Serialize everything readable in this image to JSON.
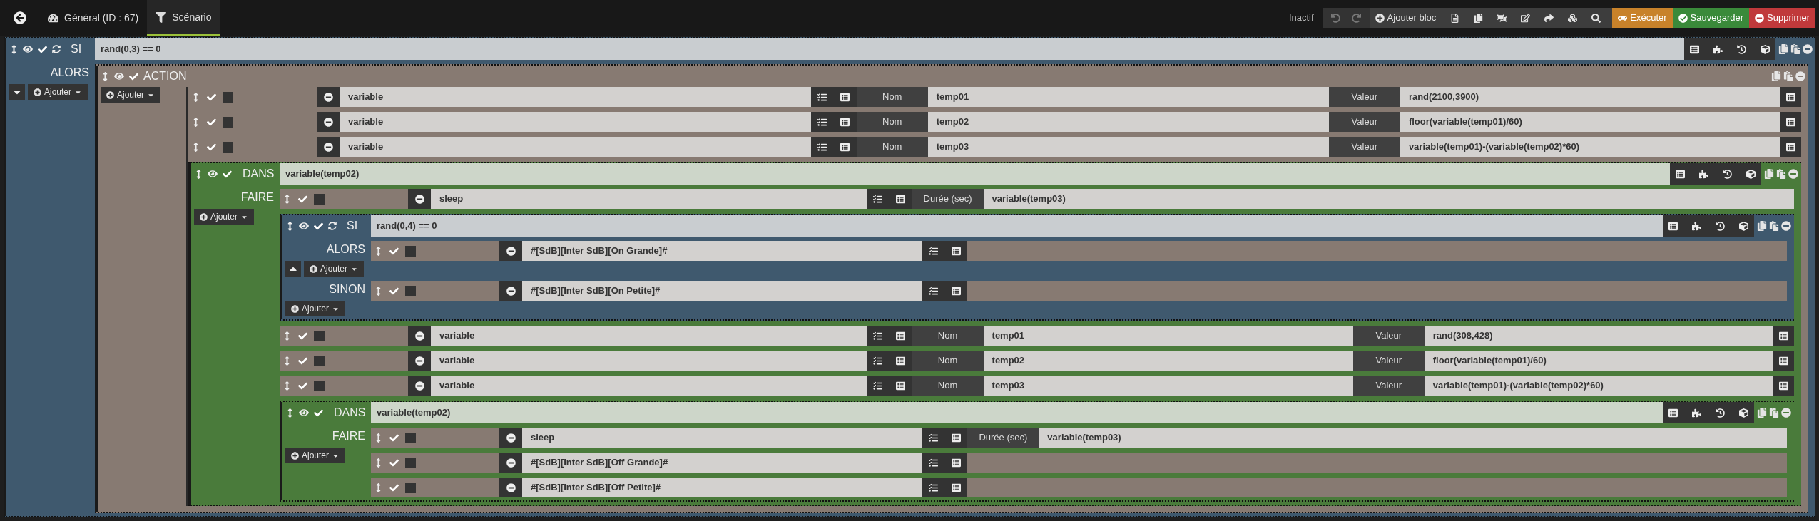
{
  "header": {
    "tabs": [
      {
        "kind": "general",
        "label": "Général (ID : 67)",
        "selected": false
      },
      {
        "kind": "scenario",
        "label": "Scénario",
        "selected": true
      }
    ],
    "state": "Inactif",
    "undo": {
      "disabled": true
    },
    "redo": {
      "disabled": true
    },
    "add_block": "Ajouter bloc",
    "actions": [
      {
        "kind": "run",
        "label": "Exécuter"
      },
      {
        "kind": "save",
        "label": "Sauvegarder"
      },
      {
        "kind": "delete",
        "label": "Supprimer"
      }
    ]
  },
  "scenario": {
    "kind": "si",
    "label": "SI",
    "enabled": true,
    "condition": "rand(0,3) == 0",
    "sections": [
      {
        "label": "ALORS",
        "expanded": false,
        "add_label": "Ajouter",
        "children": [
          {
            "kind": "action",
            "label": "ACTION",
            "enabled": true,
            "add_label": "Ajouter",
            "children": [
              {
                "kind": "element",
                "enabled": true,
                "parallel": false,
                "command": "variable",
                "fields": [
                  {
                    "label": "Nom",
                    "value": "temp01",
                    "picker": false
                  },
                  {
                    "label": "Valeur",
                    "value": "rand(2100,3900)",
                    "picker": true
                  }
                ]
              },
              {
                "kind": "element",
                "enabled": true,
                "parallel": false,
                "command": "variable",
                "fields": [
                  {
                    "label": "Nom",
                    "value": "temp02",
                    "picker": false
                  },
                  {
                    "label": "Valeur",
                    "value": "floor(variable(temp01)/60)",
                    "picker": true
                  }
                ]
              },
              {
                "kind": "element",
                "enabled": true,
                "parallel": false,
                "command": "variable",
                "fields": [
                  {
                    "label": "Nom",
                    "value": "temp03",
                    "picker": false
                  },
                  {
                    "label": "Valeur",
                    "value": "variable(temp01)-(variable(temp02)*60)",
                    "picker": true
                  }
                ]
              },
              {
                "kind": "dans",
                "label": "DANS",
                "enabled": true,
                "condition": "variable(temp02)",
                "sections": [
                  {
                    "label": "FAIRE",
                    "add_label": "Ajouter",
                    "children": [
                      {
                        "kind": "element",
                        "enabled": true,
                        "parallel": false,
                        "command": "sleep",
                        "fields": [
                          {
                            "label": "Durée (sec)",
                            "value": "variable(temp03)",
                            "picker": false
                          }
                        ]
                      },
                      {
                        "kind": "si",
                        "label": "SI",
                        "enabled": true,
                        "condition": "rand(0,4) == 0",
                        "sections": [
                          {
                            "label": "ALORS",
                            "expanded": true,
                            "add_label": "Ajouter",
                            "children": [
                              {
                                "kind": "element",
                                "enabled": true,
                                "parallel": false,
                                "command": "#[SdB][Inter SdB][On Grande]#"
                              }
                            ]
                          },
                          {
                            "label": "SINON",
                            "add_label": "Ajouter",
                            "children": [
                              {
                                "kind": "element",
                                "enabled": true,
                                "parallel": false,
                                "command": "#[SdB][Inter SdB][On Petite]#"
                              }
                            ]
                          }
                        ]
                      },
                      {
                        "kind": "element",
                        "enabled": true,
                        "parallel": false,
                        "command": "variable",
                        "fields": [
                          {
                            "label": "Nom",
                            "value": "temp01",
                            "picker": false
                          },
                          {
                            "label": "Valeur",
                            "value": "rand(308,428)",
                            "picker": true
                          }
                        ]
                      },
                      {
                        "kind": "element",
                        "enabled": true,
                        "parallel": false,
                        "command": "variable",
                        "fields": [
                          {
                            "label": "Nom",
                            "value": "temp02",
                            "picker": false
                          },
                          {
                            "label": "Valeur",
                            "value": "floor(variable(temp01)/60)",
                            "picker": true
                          }
                        ]
                      },
                      {
                        "kind": "element",
                        "enabled": true,
                        "parallel": false,
                        "command": "variable",
                        "fields": [
                          {
                            "label": "Nom",
                            "value": "temp03",
                            "picker": false
                          },
                          {
                            "label": "Valeur",
                            "value": "variable(temp01)-(variable(temp02)*60)",
                            "picker": true
                          }
                        ]
                      },
                      {
                        "kind": "dans",
                        "label": "DANS",
                        "enabled": true,
                        "condition": "variable(temp02)",
                        "sections": [
                          {
                            "label": "FAIRE",
                            "add_label": "Ajouter",
                            "children": [
                              {
                                "kind": "element",
                                "enabled": true,
                                "parallel": false,
                                "command": "sleep",
                                "fields": [
                                  {
                                    "label": "Durée (sec)",
                                    "value": "variable(temp03)",
                                    "picker": false
                                  }
                                ]
                              },
                              {
                                "kind": "element",
                                "enabled": true,
                                "parallel": false,
                                "command": "#[SdB][Inter SdB][Off Grande]#"
                              },
                              {
                                "kind": "element",
                                "enabled": true,
                                "parallel": false,
                                "command": "#[SdB][Inter SdB][Off Petite]#"
                              }
                            ]
                          }
                        ]
                      }
                    ]
                  }
                ]
              }
            ]
          }
        ]
      }
    ]
  }
}
